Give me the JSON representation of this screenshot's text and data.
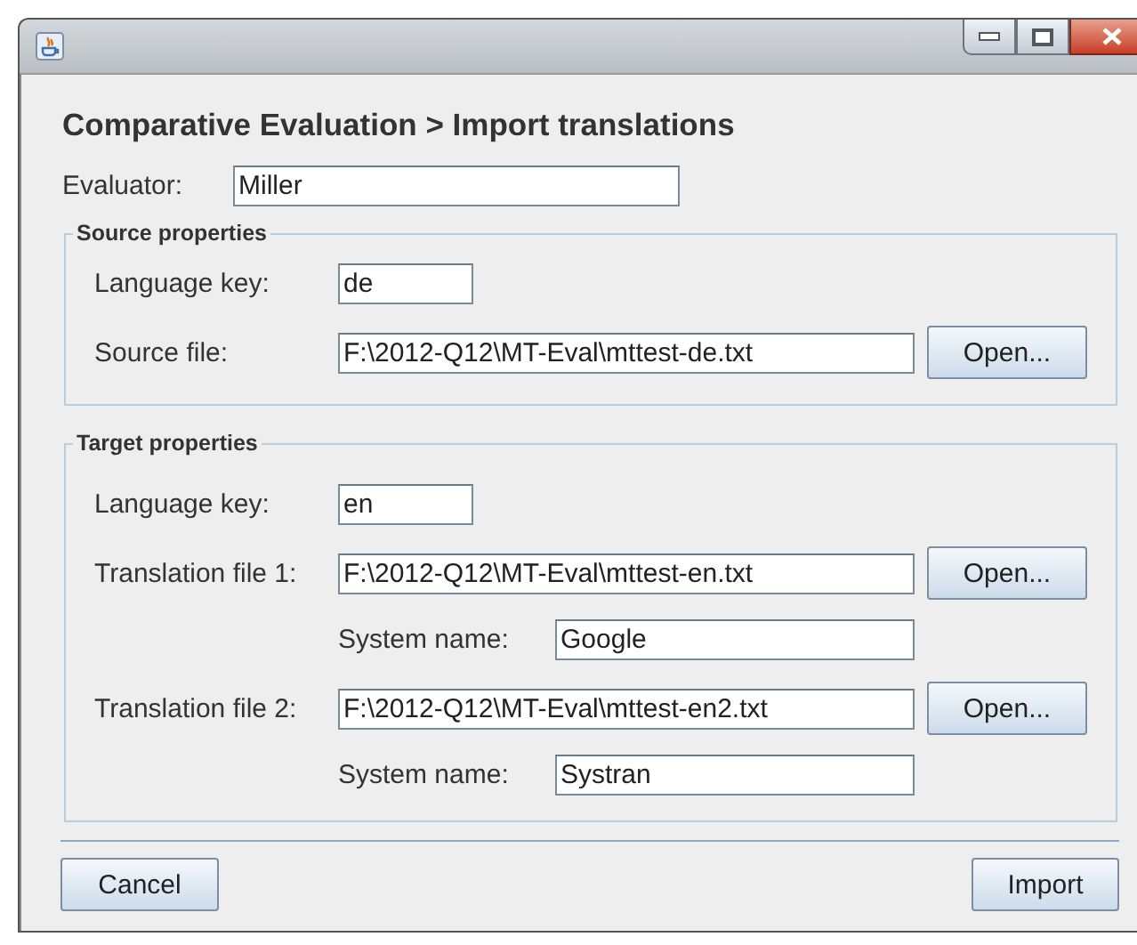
{
  "heading": "Comparative Evaluation > Import translations",
  "evaluator": {
    "label": "Evaluator:",
    "value": "Miller"
  },
  "source": {
    "title": "Source properties",
    "language_key": {
      "label": "Language key:",
      "value": "de"
    },
    "file": {
      "label": "Source file:",
      "value": "F:\\2012-Q12\\MT-Eval\\mttest-de.txt",
      "button": "Open..."
    }
  },
  "target": {
    "title": "Target properties",
    "language_key": {
      "label": "Language key:",
      "value": "en"
    },
    "translations": [
      {
        "label": "Translation file 1:",
        "value": "F:\\2012-Q12\\MT-Eval\\mttest-en.txt",
        "button": "Open...",
        "system_label": "System name:",
        "system_value": "Google"
      },
      {
        "label": "Translation file 2:",
        "value": "F:\\2012-Q12\\MT-Eval\\mttest-en2.txt",
        "button": "Open...",
        "system_label": "System name:",
        "system_value": "Systran"
      }
    ]
  },
  "buttons": [
    {
      "label": "Cancel"
    },
    {
      "label": "Import"
    }
  ]
}
